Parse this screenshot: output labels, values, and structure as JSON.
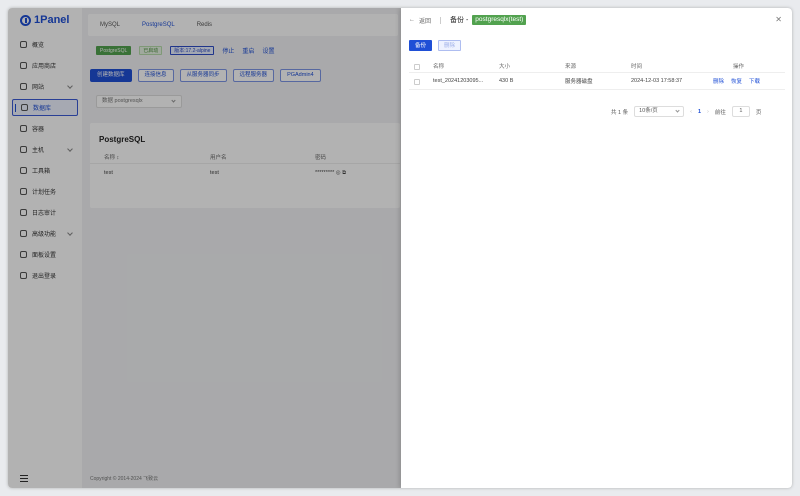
{
  "app": {
    "name": "1Panel"
  },
  "sidebar": {
    "items": [
      {
        "label": "概览",
        "icon": "home-icon",
        "chevron": false,
        "active": false
      },
      {
        "label": "应用商店",
        "icon": "app-store-icon",
        "chevron": false,
        "active": false
      },
      {
        "label": "网站",
        "icon": "globe-icon",
        "chevron": true,
        "active": false
      },
      {
        "label": "数据库",
        "icon": "database-icon",
        "chevron": false,
        "active": true
      },
      {
        "label": "容器",
        "icon": "container-icon",
        "chevron": false,
        "active": false
      },
      {
        "label": "主机",
        "icon": "host-icon",
        "chevron": true,
        "active": false
      },
      {
        "label": "工具箱",
        "icon": "toolbox-icon",
        "chevron": false,
        "active": false
      },
      {
        "label": "计划任务",
        "icon": "calendar-icon",
        "chevron": false,
        "active": false
      },
      {
        "label": "日志审计",
        "icon": "log-icon",
        "chevron": false,
        "active": false
      },
      {
        "label": "高级功能",
        "icon": "diamond-icon",
        "chevron": true,
        "active": false
      },
      {
        "label": "面板设置",
        "icon": "settings-icon",
        "chevron": false,
        "active": false
      },
      {
        "label": "退出登录",
        "icon": "logout-icon",
        "chevron": false,
        "active": false
      }
    ]
  },
  "tabs": {
    "mysql": "MySQL",
    "postgresql": "PostgreSQL",
    "redis": "Redis"
  },
  "status": {
    "app_tag": "PostgreSQL",
    "state_tag": "已启动",
    "version_tag": "版本:17.2-alpine",
    "stop": "停止",
    "restart": "重启",
    "settings": "设置"
  },
  "actions": {
    "create": "创建数据库",
    "connection": "连接信息",
    "sync": "从服务器同步",
    "remote": "远程服务器",
    "pgadmin": "PGAdmin4"
  },
  "db_select": {
    "prefix": "数据",
    "value": "postgresqlx"
  },
  "db_card": {
    "title": "PostgreSQL",
    "headers": {
      "name": "名称 ↕",
      "user": "用户名",
      "password": "密码"
    },
    "row": {
      "name": "test",
      "user": "test",
      "password": "********* ◎ ⧉"
    }
  },
  "footer": "Copyright © 2014-2024 飞致云",
  "drawer": {
    "back": "返回",
    "title": "备份 -",
    "target": "postgresqlx(test)",
    "close": "✕",
    "backup_button": "备份",
    "delete_button": "删除",
    "headers": {
      "name": "名称",
      "size": "大小",
      "source": "来源",
      "time": "时间",
      "ops": "操作"
    },
    "rows": [
      {
        "name": "test_20241203095...",
        "size": "430 B",
        "source": "服务器磁盘",
        "time": "2024-12-03 17:58:37",
        "op_delete": "删除",
        "op_restore": "恢复",
        "op_download": "下载"
      }
    ],
    "pagination": {
      "total": "共 1 条",
      "page_size": "10条/页",
      "prev": "‹",
      "page": "1",
      "next": "›",
      "goto_label": "前往",
      "goto_value": "1",
      "page_suffix": "页"
    }
  }
}
